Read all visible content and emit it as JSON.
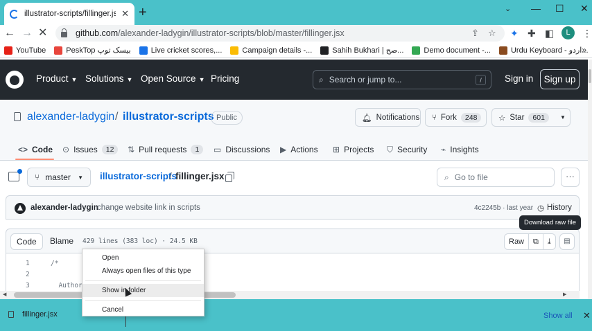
{
  "browser": {
    "tab": {
      "title": "illustrator-scripts/fillinger.jsx at m"
    },
    "url": {
      "host": "github.com",
      "path": "/alexander-ladygin/illustrator-scripts/blob/master/fillinger.jsx"
    },
    "profile_initial": "L",
    "bookmarks": [
      {
        "label": "YouTube",
        "color": "#e62117"
      },
      {
        "label": "PeskTop بیسک توپ",
        "color": "#e8453c"
      },
      {
        "label": "Live cricket scores,...",
        "color": "#1a73e8"
      },
      {
        "label": "Campaign details -...",
        "color": "#fbbc04"
      },
      {
        "label": "Sahih Bukhari | صح...",
        "color": "#202124"
      },
      {
        "label": "Demo document -...",
        "color": "#34a853"
      },
      {
        "label": "Urdu Keyboard - اردو...",
        "color": "#8a4b1f"
      }
    ]
  },
  "github": {
    "nav": [
      "Product",
      "Solutions",
      "Open Source",
      "Pricing"
    ],
    "search_placeholder": "Search or jump to...",
    "search_shortcut": "/",
    "sign_in": "Sign in",
    "sign_up": "Sign up"
  },
  "repo": {
    "owner": "alexander-ladygin",
    "separator": "/",
    "name": "illustrator-scripts",
    "visibility": "Public",
    "notifications_label": "Notifications",
    "fork_label": "Fork",
    "fork_count": "248",
    "star_label": "Star",
    "star_count": "601",
    "tabs": [
      {
        "label": "Code",
        "icon": "code-icon"
      },
      {
        "label": "Issues",
        "count": "12",
        "icon": "issue-icon"
      },
      {
        "label": "Pull requests",
        "count": "1",
        "icon": "pr-icon"
      },
      {
        "label": "Discussions",
        "icon": "discussion-icon"
      },
      {
        "label": "Actions",
        "icon": "play-icon"
      },
      {
        "label": "Projects",
        "icon": "table-icon"
      },
      {
        "label": "Security",
        "icon": "shield-icon"
      },
      {
        "label": "Insights",
        "icon": "graph-icon"
      }
    ]
  },
  "file": {
    "branch": "master",
    "crumb_repo": "illustrator-scripts",
    "crumb_sep": "/",
    "crumb_file": "fillinger.jsx",
    "goto_placeholder": "Go to file",
    "commit_author": "alexander-ladygin",
    "commit_message": "change website link in scripts",
    "commit_sha": "4c2245b · last year",
    "history_label": "History",
    "view_code": "Code",
    "view_blame": "Blame",
    "meta": "429 lines (383 loc) · 24.5 KB",
    "raw_label": "Raw",
    "tooltip": "Download raw file",
    "lines": [
      {
        "n": "1",
        "text": "/*"
      },
      {
        "n": "2",
        "text": ""
      },
      {
        "n": "3",
        "text": "  Author:"
      }
    ]
  },
  "context_menu": {
    "items": [
      "Open",
      "Always open files of this type",
      "Show in folder",
      "Cancel"
    ]
  },
  "downloads": {
    "file_name": "fillinger.jsx",
    "show_all": "Show all"
  }
}
